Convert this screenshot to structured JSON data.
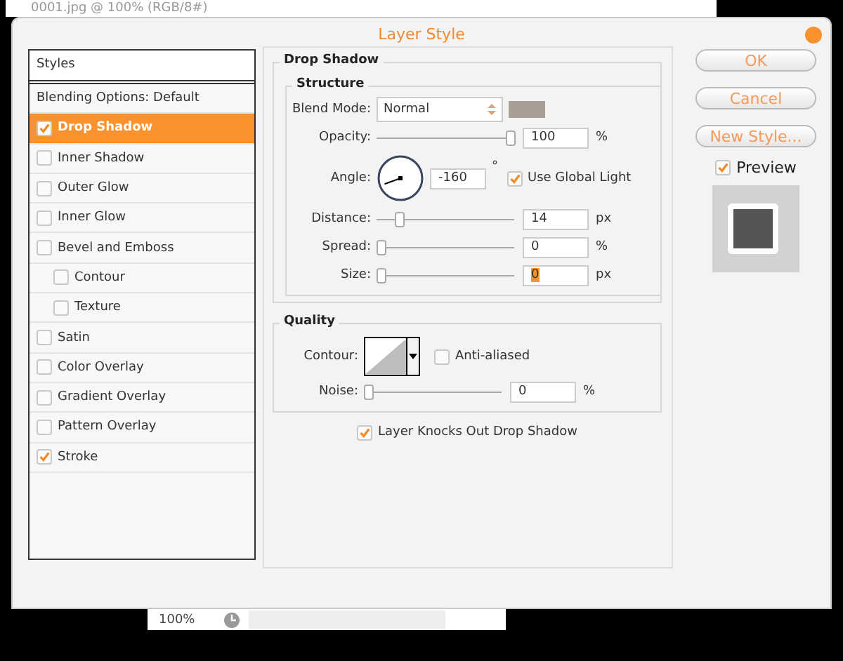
{
  "background_window": {
    "title": "0001.jpg @ 100% (RGB/8#)",
    "zoom": "100%"
  },
  "dialog": {
    "title": "Layer Style"
  },
  "styles_panel": {
    "header": "Styles",
    "blending_options": "Blending Options: Default",
    "items": [
      {
        "label": "Drop Shadow",
        "checked": true,
        "selected": true
      },
      {
        "label": "Inner Shadow",
        "checked": false,
        "selected": false
      },
      {
        "label": "Outer Glow",
        "checked": false,
        "selected": false
      },
      {
        "label": "Inner Glow",
        "checked": false,
        "selected": false
      },
      {
        "label": "Bevel and Emboss",
        "checked": false,
        "selected": false,
        "children": [
          {
            "label": "Contour",
            "checked": false,
            "selected": false
          },
          {
            "label": "Texture",
            "checked": false,
            "selected": false
          }
        ]
      },
      {
        "label": "Satin",
        "checked": false,
        "selected": false
      },
      {
        "label": "Color Overlay",
        "checked": false,
        "selected": false
      },
      {
        "label": "Gradient Overlay",
        "checked": false,
        "selected": false
      },
      {
        "label": "Pattern Overlay",
        "checked": false,
        "selected": false
      },
      {
        "label": "Stroke",
        "checked": true,
        "selected": false
      }
    ]
  },
  "drop_shadow": {
    "title": "Drop Shadow",
    "structure": {
      "title": "Structure",
      "blend_mode": {
        "label": "Blend Mode:",
        "value": "Normal",
        "color": "#a89e94"
      },
      "rows": [
        {
          "kind": "slider",
          "label": "Opacity:",
          "level": 1.0,
          "value": "100",
          "unit": "%"
        },
        {
          "kind": "angle",
          "label": "Angle:",
          "value": "-160",
          "unit": "°",
          "checkbox": {
            "label": "Use Global Light",
            "checked": true
          }
        },
        {
          "kind": "slider",
          "label": "Distance:",
          "level": 0.14,
          "value": "14",
          "unit": "px"
        },
        {
          "kind": "slider",
          "label": "Spread:",
          "level": 0,
          "value": "0",
          "unit": "%"
        },
        {
          "kind": "slider",
          "label": "Size:",
          "level": 0,
          "value": "0",
          "unit": "px",
          "text_selected": true
        }
      ]
    },
    "quality": {
      "title": "Quality",
      "contour_label": "Contour:",
      "anti_aliased": {
        "label": "Anti-aliased",
        "checked": false
      },
      "noise": {
        "label": "Noise:",
        "level": 0,
        "value": "0",
        "unit": "%"
      }
    },
    "knockout": {
      "label": "Layer Knocks Out Drop Shadow",
      "checked": true
    }
  },
  "buttons": [
    "OK",
    "Cancel",
    "New Style..."
  ],
  "preview": {
    "label": "Preview",
    "checked": true
  }
}
